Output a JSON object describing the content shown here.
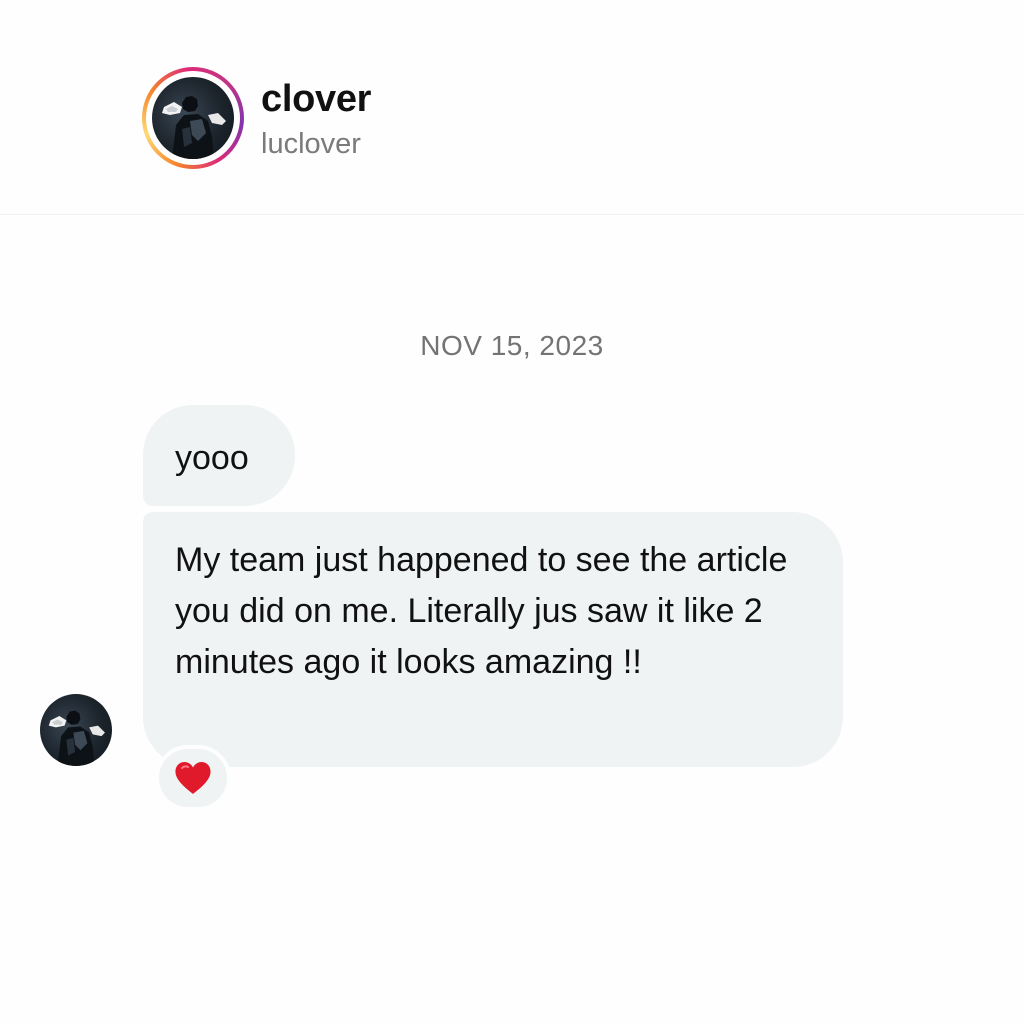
{
  "header": {
    "display_name": "clover",
    "username": "luclover",
    "avatar_icon": "profile-photo-icon",
    "story_ring_colors": [
      "#f58529",
      "#feda77",
      "#dd2a7b",
      "#8134af"
    ]
  },
  "conversation": {
    "date_divider": "NOV 15, 2023",
    "messages": [
      {
        "sender": "clover",
        "text": "yooo"
      },
      {
        "sender": "clover",
        "text": "My team just happened to see the article you did on me. Literally jus saw it like 2 minutes ago it looks amazing !!",
        "reaction": "heart-icon"
      }
    ],
    "bubble_color": "#eff3f4",
    "reaction_color": "#e0192b"
  }
}
